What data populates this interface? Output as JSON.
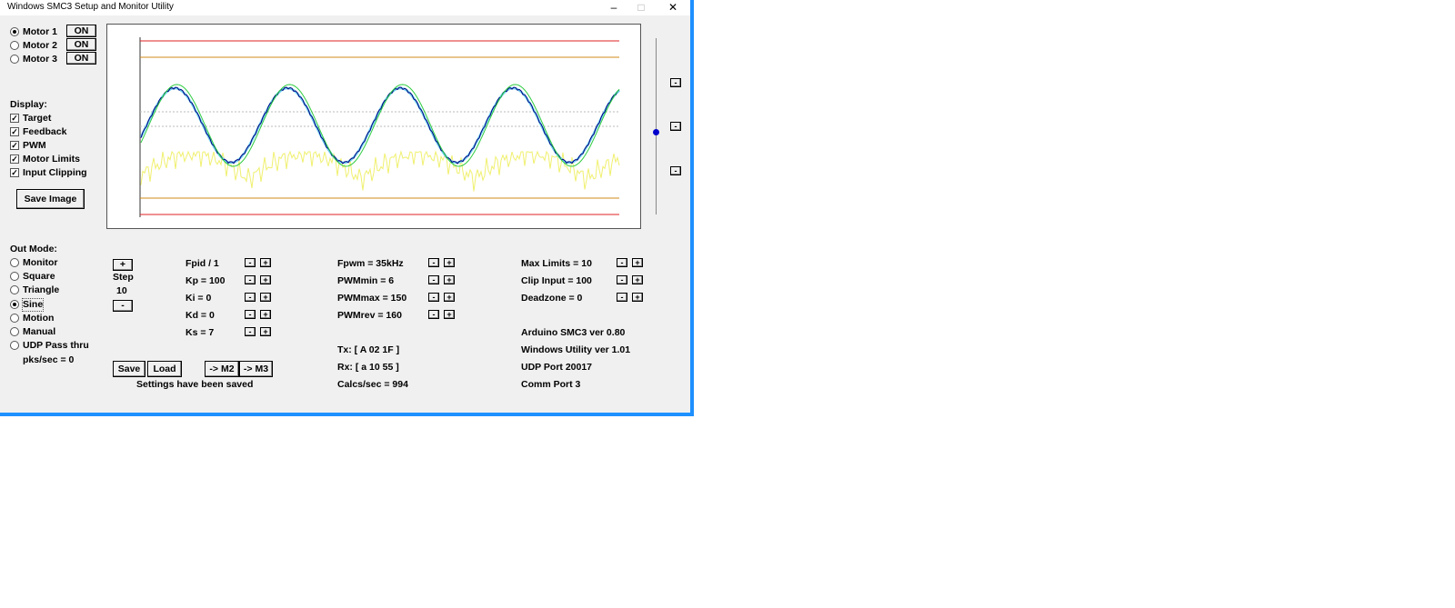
{
  "window": {
    "title": "Windows SMC3 Setup and Monitor Utility",
    "minimize": "–",
    "maximize": "□",
    "close": "✕"
  },
  "motors": [
    {
      "label": "Motor 1",
      "button": "ON",
      "selected": true
    },
    {
      "label": "Motor 2",
      "button": "ON",
      "selected": false
    },
    {
      "label": "Motor 3",
      "button": "ON",
      "selected": false
    }
  ],
  "display": {
    "heading": "Display:",
    "items": [
      "Target",
      "Feedback",
      "PWM",
      "Motor Limits",
      "Input Clipping"
    ],
    "save_image": "Save Image"
  },
  "out_mode": {
    "heading": "Out Mode:",
    "options": [
      "Monitor",
      "Square",
      "Triangle",
      "Sine",
      "Motion",
      "Manual",
      "UDP Pass thru"
    ],
    "selected": "Sine",
    "pks": "pks/sec = 0"
  },
  "step": {
    "plus": "+",
    "label": "Step",
    "value": "10",
    "minus": "-"
  },
  "pid": [
    "Fpid / 1",
    "Kp = 100",
    "Ki = 0",
    "Kd = 0",
    "Ks = 7"
  ],
  "pwm": [
    "Fpwm = 35kHz",
    "PWMmin = 6",
    "PWMmax = 150",
    "PWMrev = 160"
  ],
  "limits": [
    "Max Limits = 10",
    "Clip Input = 100",
    "Deadzone = 0"
  ],
  "comm": {
    "tx": "Tx: [ A 02 1F ]",
    "rx": "Rx: [ a 10 55 ]",
    "calcs": "Calcs/sec = 994"
  },
  "info": {
    "arduino": "Arduino SMC3 ver 0.80",
    "utility": "Windows Utility ver 1.01",
    "udp": "UDP Port 20017",
    "comm_port": "Comm Port 3"
  },
  "buttons": {
    "save": "Save",
    "load": "Load",
    "to_m2": "-> M2",
    "to_m3": "-> M3",
    "minus": "-",
    "plus": "+"
  },
  "status": "Settings have been saved",
  "colors": {
    "limit": "#e02020",
    "clip": "#d08a1a",
    "feedback": "#2ecc40",
    "target": "#70d0f0",
    "target_dark": "#000080",
    "pwm": "#f0f070",
    "accent": "#1e90ff"
  }
}
